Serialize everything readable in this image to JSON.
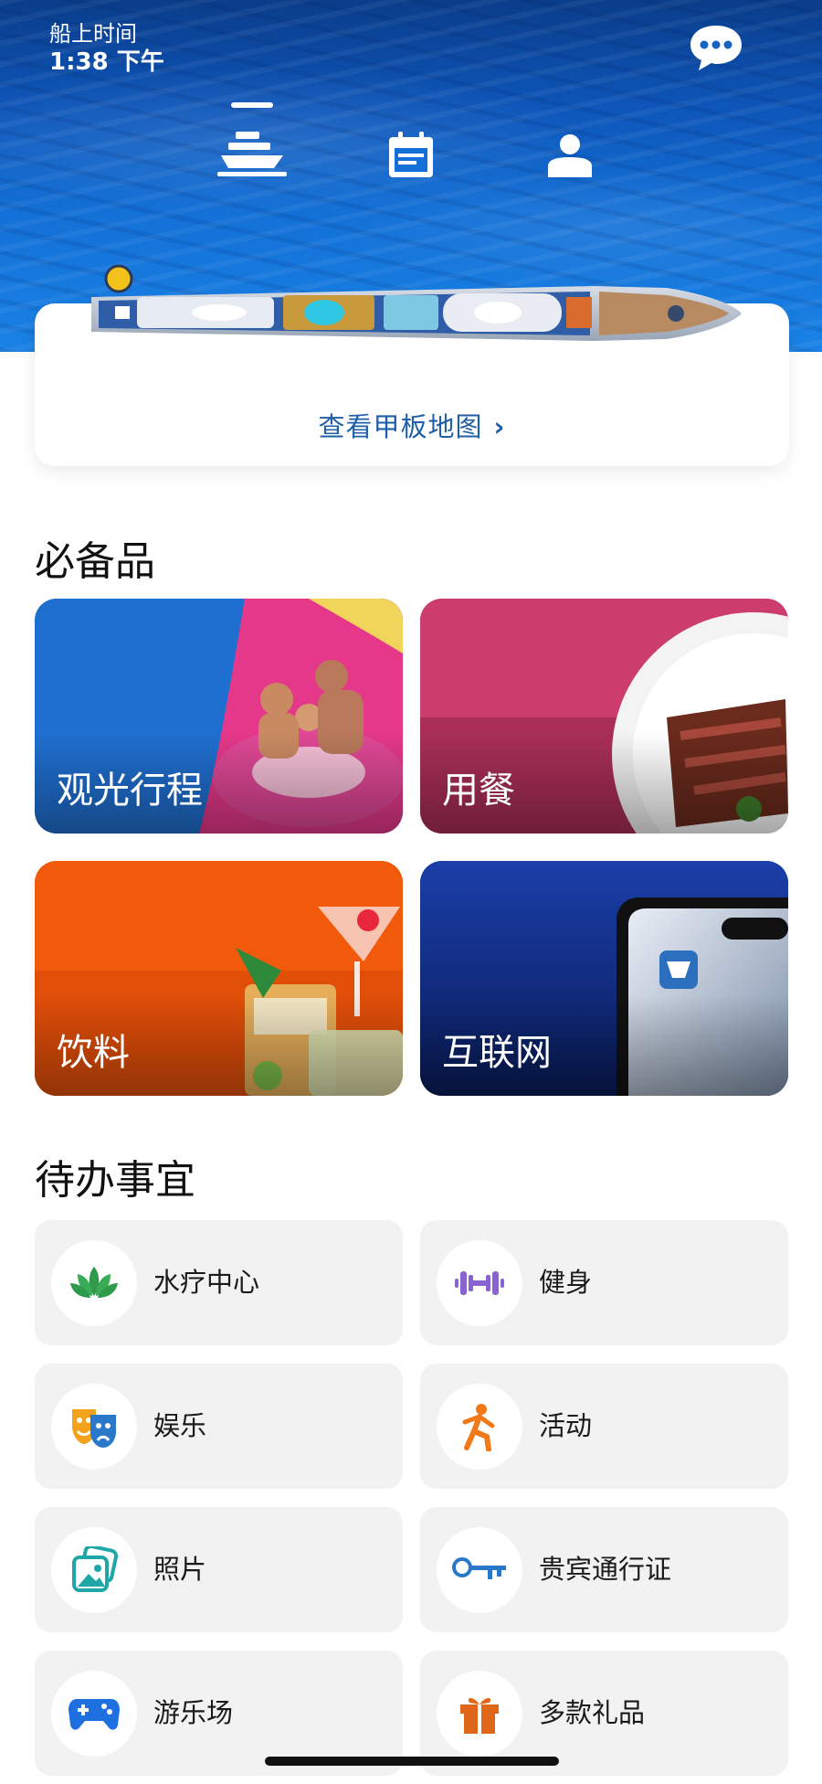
{
  "status": {
    "ship_time_label": "船上时间",
    "ship_time_value": "1:38 下午"
  },
  "header": {
    "chat_icon": "chat-bubble-icon",
    "nav": [
      {
        "icon": "ship-icon",
        "active": true
      },
      {
        "icon": "calendar-icon",
        "active": false
      },
      {
        "icon": "person-icon",
        "active": false
      }
    ]
  },
  "deck_map": {
    "link_label": "查看甲板地图",
    "chevron": "›"
  },
  "essentials": {
    "title": "必备品",
    "tiles": [
      {
        "label": "观光行程"
      },
      {
        "label": "用餐"
      },
      {
        "label": "饮料"
      },
      {
        "label": "互联网"
      }
    ]
  },
  "todo": {
    "title": "待办事宜",
    "items": [
      {
        "label": "水疗中心",
        "icon": "lotus-icon",
        "color": "#2e9a4a"
      },
      {
        "label": "健身",
        "icon": "dumbbell-icon",
        "color": "#8a63d2"
      },
      {
        "label": "娱乐",
        "icon": "theater-masks-icon",
        "color": "#f2a31b"
      },
      {
        "label": "活动",
        "icon": "running-person-icon",
        "color": "#f07a1a"
      },
      {
        "label": "照片",
        "icon": "photos-icon",
        "color": "#1fa6a6"
      },
      {
        "label": "贵宾通行证",
        "icon": "key-icon",
        "color": "#2a78c9"
      },
      {
        "label": "游乐场",
        "icon": "gamepad-icon",
        "color": "#1e6fe0"
      },
      {
        "label": "多款礼品",
        "icon": "gift-icon",
        "color": "#e0661a"
      }
    ]
  },
  "colors": {
    "link": "#1f5fa8",
    "card_bg": "#f2f2f2"
  }
}
